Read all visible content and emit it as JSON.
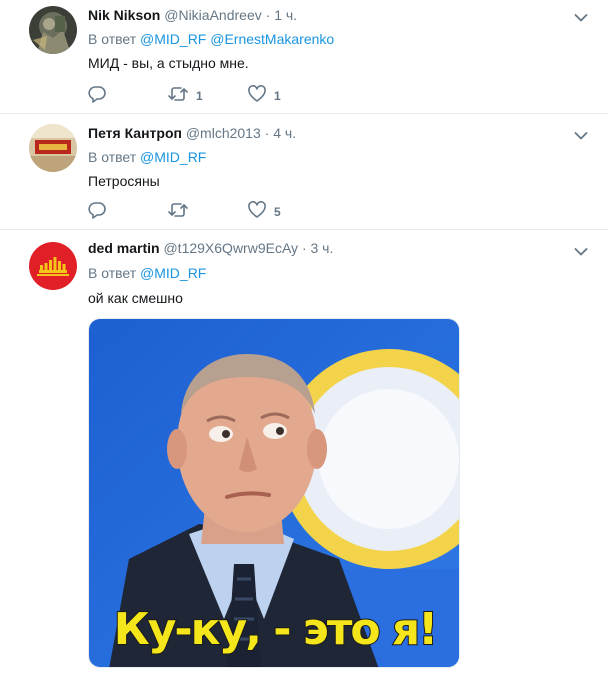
{
  "reply_prefix": "В ответ",
  "tweets": [
    {
      "name": "Nik Nikson",
      "handle": "@NikiaAndreev",
      "separator": "·",
      "time": "1 ч.",
      "reply_to": [
        "@MID_RF",
        "@ErnestMakarenko"
      ],
      "text": "МИД - вы, а стыдно мне.",
      "reply_count": "",
      "retweet_count": "1",
      "like_count": "1"
    },
    {
      "name": "Петя Кантроп",
      "handle": "@mlch2013",
      "separator": "·",
      "time": "4 ч.",
      "reply_to": [
        "@MID_RF"
      ],
      "text": "Петросяны",
      "reply_count": "",
      "retweet_count": "",
      "like_count": "5"
    },
    {
      "name": "ded martin",
      "handle": "@t129X6Qwrw9EcAy",
      "separator": "·",
      "time": "3 ч.",
      "reply_to": [
        "@MID_RF"
      ],
      "text": "ой как смешно",
      "media_caption": "Ку-ку, - это я!"
    }
  ],
  "colors": {
    "link": "#1b95e0",
    "secondary": "#657786",
    "divider": "#e6ecf0",
    "caption": "#f4e61a"
  },
  "icons": [
    "chevron-down-icon",
    "reply-icon",
    "retweet-icon",
    "heart-icon"
  ]
}
